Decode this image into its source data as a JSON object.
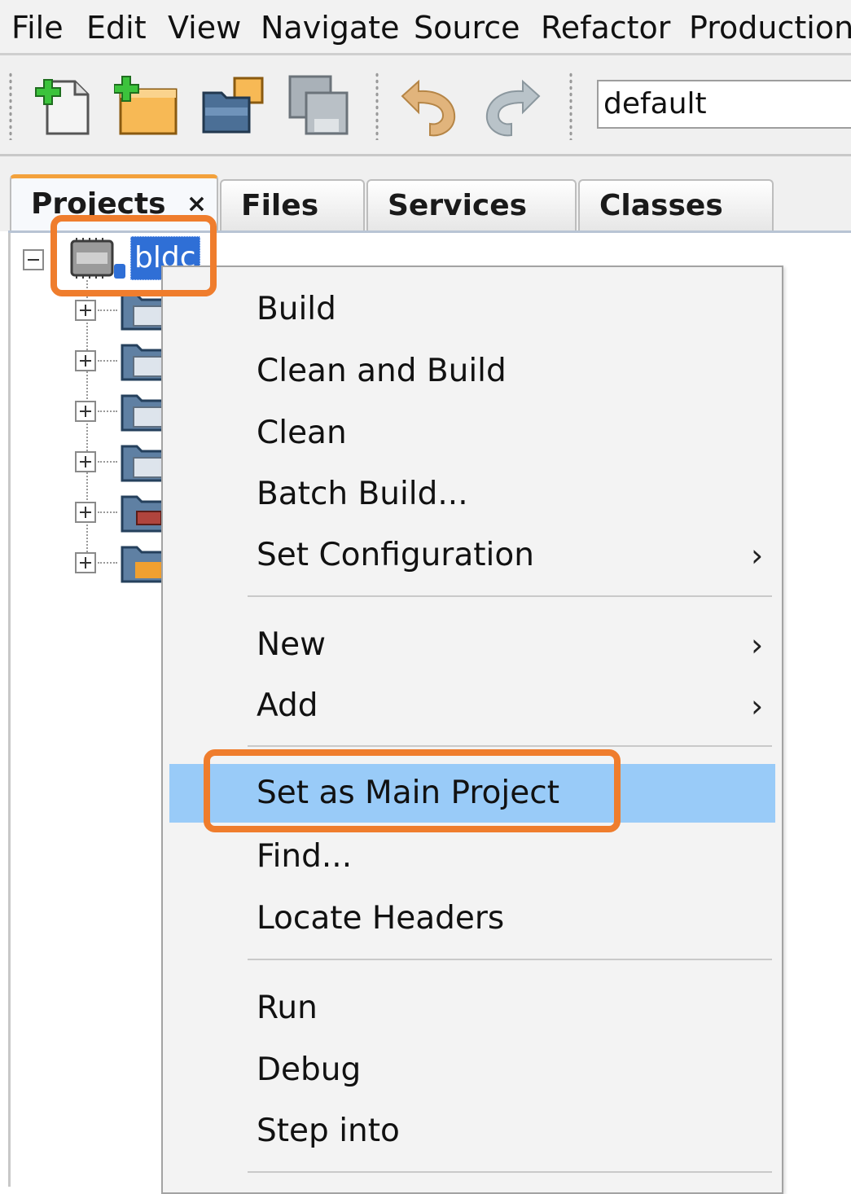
{
  "menubar": {
    "items": [
      "File",
      "Edit",
      "View",
      "Navigate",
      "Source",
      "Refactor",
      "Production"
    ]
  },
  "toolbar": {
    "buttons": [
      "new-file-icon",
      "new-project-icon",
      "open-project-icon",
      "save-all-icon",
      "undo-icon",
      "redo-icon"
    ],
    "configuration": "default"
  },
  "tabs": [
    {
      "label": "Projects",
      "close": "×",
      "active": true
    },
    {
      "label": "Files"
    },
    {
      "label": "Services"
    },
    {
      "label": "Classes"
    }
  ],
  "tree": {
    "root": "bldc",
    "children_icons": [
      "header-files-folder-icon",
      "library-files-folder-icon",
      "linker-files-folder-icon",
      "source-files-folder-icon",
      "libraries-folder-icon",
      "loadables-folder-icon"
    ]
  },
  "context_menu": {
    "items": [
      {
        "label": "Build"
      },
      {
        "label": "Clean and Build"
      },
      {
        "label": "Clean"
      },
      {
        "label": "Batch Build..."
      },
      {
        "label": "Set Configuration",
        "submenu": true
      },
      {
        "label": "New",
        "submenu": true
      },
      {
        "label": "Add",
        "submenu": true
      },
      {
        "label": "Set as Main Project",
        "selected": true
      },
      {
        "label": "Find..."
      },
      {
        "label": "Locate Headers"
      },
      {
        "label": "Run"
      },
      {
        "label": "Debug"
      },
      {
        "label": "Step into"
      }
    ],
    "submenu_arrow": "›"
  },
  "colors": {
    "highlight_box": "#ef7d2d",
    "selection_blue": "#2f6fd6",
    "menu_hover": "#99cbf8",
    "active_tab_accent": "#f3a13b"
  }
}
